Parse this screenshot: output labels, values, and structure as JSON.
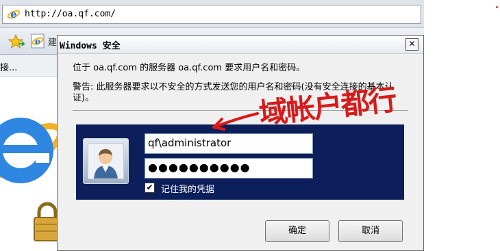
{
  "browser": {
    "address": "http://oa.qf.com/",
    "tab_fragment": "建",
    "status_fragment": "接..."
  },
  "dialog": {
    "title": "Windows 安全",
    "close_glyph": "✕",
    "message": "位于 oa.qf.com 的服务器 oa.qf.com 要求用户名和密码。",
    "warning": "警告: 此服务器要求以不安全的方式发送您的用户名和密码(没有安全连接的基本认证)。",
    "username": "qf\\administrator",
    "password_masked": "●●●●●●●●●●",
    "remember_label": "记住我的凭据",
    "remember_checked": true,
    "remember_check_glyph": "✔",
    "ok_label": "确定",
    "cancel_label": "取消"
  },
  "annotation": {
    "text": "域帐户都行",
    "color": "#d81a1a"
  },
  "colors": {
    "panel": "#0d1f5a",
    "ie_blue": "#1e6fd0",
    "ie_ring": "#f2b227",
    "marker": "#e03030"
  },
  "icons": [
    "ie-icon",
    "favorites-star-icon",
    "add-favorite-icon",
    "user-avatar-icon",
    "lock-icon",
    "arrow-icon"
  ]
}
